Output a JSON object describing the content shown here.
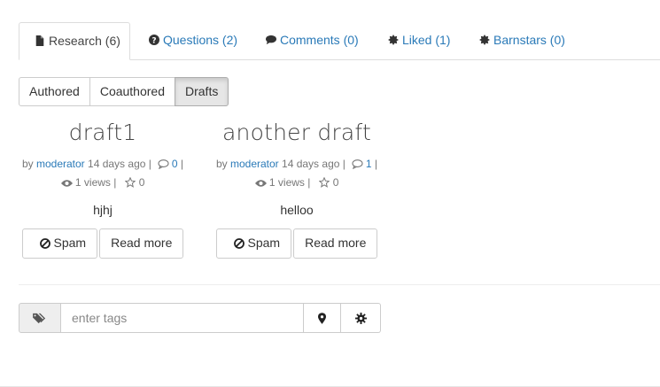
{
  "tabs": [
    {
      "label": "Research (6)",
      "icon": "file-icon",
      "active": true
    },
    {
      "label": "Questions (2)",
      "icon": "question-circle-icon"
    },
    {
      "label": "Comments (0)",
      "icon": "comment-icon"
    },
    {
      "label": "Liked (1)",
      "icon": "badge-icon"
    },
    {
      "label": "Barnstars (0)",
      "icon": "badge-icon"
    }
  ],
  "filters": {
    "authored": "Authored",
    "coauthored": "Coauthored",
    "drafts": "Drafts",
    "active": "Drafts"
  },
  "cards": [
    {
      "title": "draft1",
      "by": "by",
      "author": "moderator",
      "time": "14 days ago |",
      "comments": "0",
      "sep": "|",
      "views": "1 views |",
      "likes": "0",
      "body": "hjhj",
      "spam_label": "Spam",
      "read_more_label": "Read more"
    },
    {
      "title": "another draft",
      "by": "by",
      "author": "moderator",
      "time": "14 days ago |",
      "comments": "1",
      "sep": "|",
      "views": "1 views |",
      "likes": "0",
      "body": "helloo",
      "spam_label": "Spam",
      "read_more_label": "Read more"
    }
  ],
  "tags": {
    "placeholder": "enter tags"
  },
  "colors": {
    "link": "#2a7ab8",
    "border": "#cccccc",
    "active_bg": "#e6e6e6"
  }
}
